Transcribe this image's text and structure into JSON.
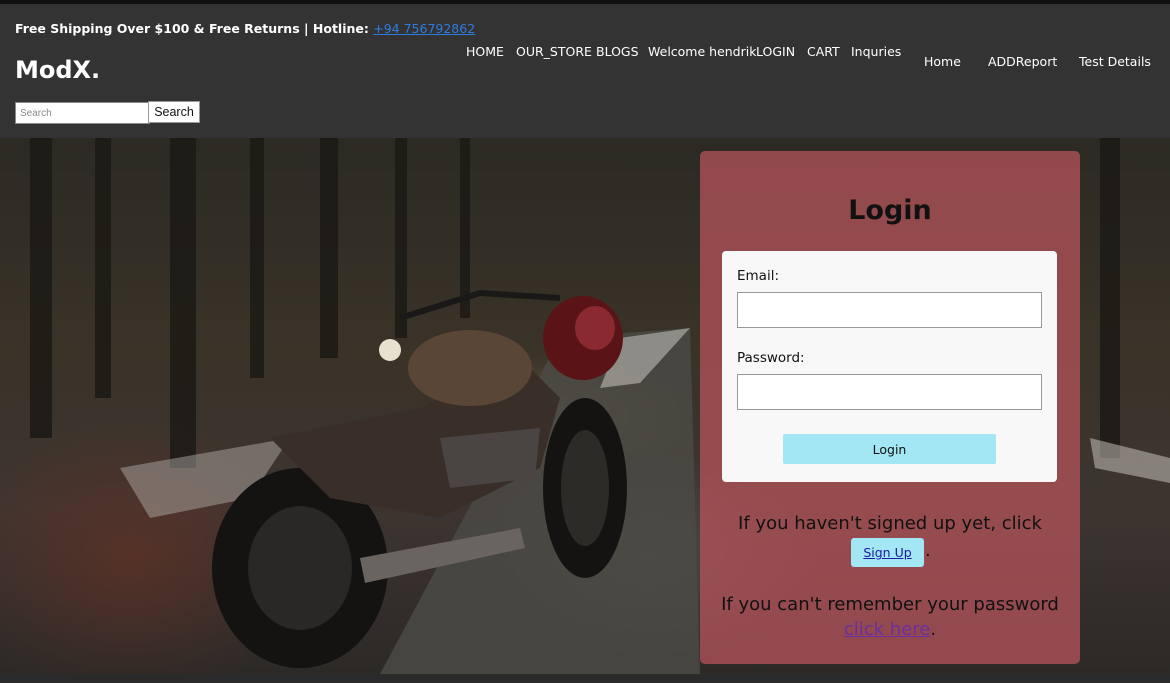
{
  "header": {
    "promo_text": "Free Shipping Over $100 & Free Returns | Hotline: ",
    "hotline": "+94 756792862",
    "brand": "ModX.",
    "search_placeholder": "Search",
    "search_button": "Search",
    "nav": [
      "HOME",
      "OUR_STORE",
      "BLOGS",
      "Welcome hendrik",
      "LOGIN",
      "CART",
      "Inquries"
    ],
    "nav_secondary": [
      "Home",
      "ADDReport",
      "Test Details"
    ]
  },
  "login": {
    "title": "Login",
    "email_label": "Email:",
    "password_label": "Password:",
    "submit_label": "Login",
    "signup_text": "If you haven't signed up yet, click",
    "signup_button": "Sign Up",
    "signup_suffix": ".",
    "forgot_text": "If you can't remember your password",
    "forgot_link": "click here",
    "forgot_suffix": "."
  },
  "colors": {
    "header_bg": "#333333",
    "card_bg": "#b05258",
    "accent_button": "#a3e6f4",
    "hotline_link": "#2f7ce0",
    "visited_link": "#6a2fa0"
  }
}
